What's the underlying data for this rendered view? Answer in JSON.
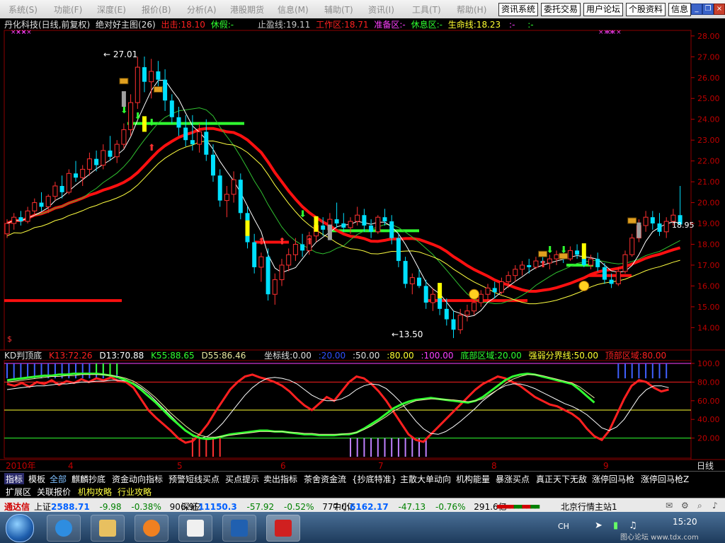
{
  "menubar": {
    "items": [
      "系统(S)",
      "功能(F)",
      "深度(E)",
      "报价(B)",
      "分析(A)",
      "港股期货",
      "信息(M)",
      "辅助(T)",
      "资讯(I)",
      "工具(T)",
      "帮助(H)"
    ],
    "buttons": [
      "资讯系统",
      "委托交易",
      "用户论坛",
      "个股资料",
      "信息"
    ]
  },
  "main_header": {
    "stock": "丹化科技(日线,前复权)",
    "indicator": "绝对好主图(26)",
    "items": [
      {
        "label": "出击:18.10",
        "color": "#ff2020"
      },
      {
        "label": "休假:-",
        "color": "#30ff30"
      },
      {
        "label": "止盈线:19.11",
        "color": "#c8c8c8"
      },
      {
        "label": "工作区:18.71",
        "color": "#ff2020"
      },
      {
        "label": "准备区:-",
        "color": "#ff40ff"
      },
      {
        "label": "休息区:-",
        "color": "#30ff30"
      },
      {
        "label": "生命线:18.23",
        "color": "#ffff30"
      },
      {
        "label": ":-",
        "color": "#ff40ff"
      },
      {
        "label": ":-",
        "color": "#30ff30"
      }
    ]
  },
  "annotations": {
    "high": "27.01",
    "low": "13.50",
    "last": "18.95"
  },
  "sub_header": {
    "items": [
      {
        "label": "KD判顶底",
        "color": "#e0e0e0"
      },
      {
        "label": "K13:72.26",
        "color": "#ff2020"
      },
      {
        "label": "D13:70.88",
        "color": "#ffffff"
      },
      {
        "label": "K55:88.65",
        "color": "#30ff30"
      },
      {
        "label": "D55:86.46",
        "color": "#e8e8a0"
      },
      {
        "label": "坐标线:0.00",
        "color": "#e0e0e0"
      },
      {
        "label": ":20.00",
        "color": "#3050ff"
      },
      {
        "label": ":50.00",
        "color": "#e0e0e0"
      },
      {
        "label": ":80.00",
        "color": "#ffff30"
      },
      {
        "label": ":100.00",
        "color": "#ff40ff"
      },
      {
        "label": "底部区域:20.00",
        "color": "#30ff30"
      },
      {
        "label": "强弱分界线:50.00",
        "color": "#ffff30"
      },
      {
        "label": "顶部区域:80.00",
        "color": "#ff2020"
      }
    ]
  },
  "axis": {
    "price_ticks": [
      "28.00",
      "27.00",
      "26.00",
      "25.00",
      "24.00",
      "23.00",
      "22.00",
      "21.00",
      "20.00",
      "19.00",
      "18.00",
      "17.00",
      "16.00",
      "15.00",
      "14.00"
    ],
    "osc_ticks": [
      "100.0",
      "80.00",
      "60.00",
      "40.00",
      "20.00"
    ],
    "period_label": "日线",
    "date_labels": [
      "2010年",
      "4",
      "5",
      "6",
      "7",
      "8",
      "9"
    ]
  },
  "chart_data": {
    "type": "candlestick",
    "price_range": [
      13.3,
      28.3
    ],
    "candles": [
      [
        18.5,
        19.2,
        18.3,
        19.0
      ],
      [
        19.0,
        19.5,
        18.7,
        19.3
      ],
      [
        19.3,
        19.6,
        18.9,
        19.1
      ],
      [
        19.1,
        19.8,
        19.0,
        19.6
      ],
      [
        19.6,
        20.2,
        19.4,
        20.0
      ],
      [
        20.0,
        20.5,
        19.6,
        19.8
      ],
      [
        19.8,
        20.4,
        19.5,
        20.3
      ],
      [
        20.3,
        21.0,
        20.1,
        20.8
      ],
      [
        20.8,
        21.3,
        20.2,
        20.5
      ],
      [
        20.5,
        21.6,
        20.4,
        21.4
      ],
      [
        21.4,
        22.0,
        21.0,
        21.2
      ],
      [
        21.2,
        21.8,
        20.8,
        21.6
      ],
      [
        21.6,
        22.4,
        21.3,
        22.1
      ],
      [
        22.1,
        22.5,
        21.5,
        21.8
      ],
      [
        21.8,
        22.8,
        21.6,
        22.5
      ],
      [
        22.5,
        23.2,
        22.0,
        22.2
      ],
      [
        22.2,
        23.0,
        21.9,
        22.8
      ],
      [
        22.8,
        23.8,
        22.6,
        23.5
      ],
      [
        23.5,
        25.2,
        23.2,
        24.8
      ],
      [
        24.8,
        27.0,
        24.5,
        26.5
      ],
      [
        26.5,
        27.01,
        25.3,
        25.8
      ],
      [
        25.8,
        26.9,
        25.0,
        26.3
      ],
      [
        26.3,
        26.8,
        25.5,
        25.9
      ],
      [
        25.9,
        26.4,
        24.4,
        24.9
      ],
      [
        24.9,
        25.2,
        23.8,
        24.1
      ],
      [
        24.1,
        24.6,
        23.2,
        23.6
      ],
      [
        23.6,
        24.2,
        22.7,
        23.0
      ],
      [
        23.0,
        24.2,
        22.5,
        22.8
      ],
      [
        22.8,
        23.8,
        22.4,
        23.4
      ],
      [
        23.4,
        24.0,
        22.0,
        22.3
      ],
      [
        22.3,
        22.8,
        21.0,
        21.3
      ],
      [
        21.3,
        21.6,
        19.8,
        20.1
      ],
      [
        20.1,
        20.8,
        19.3,
        20.4
      ],
      [
        20.4,
        21.5,
        20.0,
        21.1
      ],
      [
        21.1,
        21.4,
        19.2,
        19.5
      ],
      [
        19.5,
        19.8,
        17.8,
        18.1
      ],
      [
        18.1,
        18.5,
        16.6,
        16.9
      ],
      [
        16.9,
        17.6,
        16.2,
        17.4
      ],
      [
        17.4,
        17.8,
        15.3,
        15.6
      ],
      [
        15.6,
        16.6,
        15.1,
        16.3
      ],
      [
        16.3,
        17.3,
        16.0,
        17.0
      ],
      [
        17.0,
        17.8,
        16.7,
        17.5
      ],
      [
        17.5,
        18.3,
        17.2,
        18.0
      ],
      [
        18.0,
        18.5,
        17.4,
        17.7
      ],
      [
        17.7,
        18.6,
        17.5,
        18.4
      ],
      [
        18.4,
        19.2,
        18.1,
        18.9
      ],
      [
        18.9,
        19.3,
        18.4,
        18.7
      ],
      [
        18.7,
        19.5,
        18.5,
        19.2
      ],
      [
        19.2,
        20.0,
        18.8,
        19.0
      ],
      [
        19.0,
        19.5,
        18.6,
        18.8
      ],
      [
        18.8,
        19.3,
        18.5,
        19.1
      ],
      [
        19.1,
        19.8,
        18.9,
        19.4
      ],
      [
        19.4,
        19.7,
        18.6,
        18.9
      ],
      [
        18.9,
        19.2,
        18.3,
        18.6
      ],
      [
        18.6,
        19.4,
        18.5,
        19.3
      ],
      [
        19.3,
        19.7,
        18.9,
        19.1
      ],
      [
        19.1,
        19.4,
        18.0,
        18.3
      ],
      [
        18.3,
        18.5,
        16.9,
        17.2
      ],
      [
        17.2,
        17.4,
        15.9,
        16.1
      ],
      [
        16.1,
        16.6,
        15.6,
        16.4
      ],
      [
        16.4,
        16.8,
        15.9,
        16.0
      ],
      [
        16.0,
        16.3,
        14.9,
        15.2
      ],
      [
        15.2,
        15.9,
        14.8,
        15.6
      ],
      [
        15.6,
        15.8,
        14.6,
        14.9
      ],
      [
        14.9,
        15.4,
        14.1,
        14.4
      ],
      [
        14.4,
        14.8,
        13.5,
        13.9
      ],
      [
        13.9,
        14.9,
        13.7,
        14.6
      ],
      [
        14.6,
        15.1,
        14.3,
        14.8
      ],
      [
        14.8,
        15.4,
        14.6,
        15.2
      ],
      [
        15.2,
        15.8,
        15.0,
        15.6
      ],
      [
        15.6,
        16.1,
        15.3,
        15.9
      ],
      [
        15.9,
        16.2,
        15.4,
        15.7
      ],
      [
        15.7,
        16.4,
        15.6,
        16.2
      ],
      [
        16.2,
        16.7,
        15.9,
        16.5
      ],
      [
        16.5,
        17.0,
        16.2,
        16.8
      ],
      [
        16.8,
        17.2,
        16.5,
        17.0
      ],
      [
        17.0,
        17.3,
        16.6,
        16.9
      ],
      [
        16.9,
        17.4,
        16.8,
        17.2
      ],
      [
        17.2,
        17.5,
        16.9,
        17.1
      ],
      [
        17.1,
        17.5,
        16.8,
        17.3
      ],
      [
        17.3,
        17.7,
        17.0,
        17.5
      ],
      [
        17.5,
        17.8,
        17.1,
        17.3
      ],
      [
        17.3,
        17.9,
        17.2,
        17.7
      ],
      [
        17.7,
        18.0,
        17.3,
        17.5
      ],
      [
        17.5,
        17.8,
        16.9,
        17.0
      ],
      [
        17.0,
        17.5,
        16.8,
        17.3
      ],
      [
        17.3,
        17.6,
        16.7,
        16.9
      ],
      [
        16.9,
        17.1,
        16.1,
        16.3
      ],
      [
        16.3,
        16.6,
        15.9,
        16.1
      ],
      [
        16.1,
        16.9,
        16.0,
        16.7
      ],
      [
        16.7,
        17.7,
        16.6,
        17.5
      ],
      [
        17.5,
        18.5,
        17.4,
        18.3
      ],
      [
        18.3,
        19.2,
        18.1,
        18.9
      ],
      [
        18.9,
        19.6,
        18.6,
        19.3
      ],
      [
        19.3,
        19.6,
        18.7,
        19.0
      ],
      [
        19.0,
        19.5,
        18.4,
        18.6
      ],
      [
        18.6,
        19.3,
        18.3,
        19.1
      ],
      [
        19.1,
        19.7,
        18.9,
        19.4
      ],
      [
        19.4,
        20.8,
        19.0,
        18.95
      ]
    ],
    "ma_fast_start": 18.6,
    "ma_slow_start": 17.8,
    "oscillator": {
      "range": [
        0,
        100
      ],
      "levels": [
        20,
        50,
        80,
        100
      ],
      "series": [
        {
          "name": "K13",
          "color": "#ff2020",
          "values": [
            78,
            76,
            79,
            75,
            80,
            78,
            82,
            77,
            81,
            79,
            83,
            80,
            84,
            82,
            85,
            81,
            80,
            74,
            62,
            50,
            42,
            35,
            28,
            20,
            15,
            17,
            25,
            35,
            48,
            60,
            72,
            80,
            86,
            88,
            85,
            83,
            80,
            76,
            70,
            62,
            55,
            50,
            57,
            64,
            60,
            70,
            80,
            86,
            84,
            78,
            70,
            60,
            48,
            36,
            24,
            18,
            16,
            24,
            32,
            40,
            48,
            56,
            64,
            72,
            78,
            82,
            86,
            84,
            80,
            76,
            70,
            64,
            60,
            56,
            54,
            50,
            46,
            40,
            30,
            22,
            18,
            28,
            45,
            62,
            76,
            82,
            80,
            74,
            70,
            72
          ]
        },
        {
          "name": "D13",
          "color": "#ffffff",
          "values": [
            72,
            73,
            74,
            75,
            76,
            76,
            77,
            78,
            78,
            79,
            80,
            80,
            81,
            81,
            82,
            82,
            81,
            79,
            74,
            68,
            60,
            52,
            44,
            36,
            28,
            22,
            20,
            22,
            28,
            36,
            46,
            56,
            66,
            74,
            80,
            84,
            85,
            84,
            82,
            78,
            72,
            66,
            62,
            60,
            60,
            62,
            66,
            72,
            76,
            78,
            77,
            73,
            66,
            58,
            48,
            38,
            30,
            25,
            24,
            27,
            32,
            38,
            45,
            52,
            60,
            66,
            72,
            76,
            78,
            78,
            76,
            73,
            69,
            65,
            61,
            57,
            54,
            50,
            45,
            38,
            31,
            28,
            32,
            40,
            52,
            64,
            72,
            76,
            76,
            74
          ]
        },
        {
          "name": "K55",
          "color": "#30ff30",
          "values": [
            82,
            83,
            84,
            85,
            86,
            87,
            87,
            88,
            88,
            89,
            89,
            89,
            89,
            88,
            87,
            85,
            82,
            78,
            72,
            65,
            58,
            50,
            42,
            35,
            28,
            23,
            20,
            19,
            20,
            22,
            24,
            25,
            26,
            27,
            28,
            28,
            27,
            27,
            26,
            25,
            24,
            24,
            23,
            23,
            23,
            24,
            24,
            26,
            30,
            35,
            40,
            46,
            52,
            56,
            59,
            61,
            62,
            63,
            62,
            61,
            60,
            59,
            58,
            60,
            64,
            70,
            76,
            82,
            86,
            88,
            89,
            88,
            86,
            84,
            82,
            80,
            78,
            72,
            65,
            58
          ]
        },
        {
          "name": "D55",
          "color": "#e8e8a0",
          "values": [
            80,
            81,
            82,
            83,
            84,
            85,
            86,
            86,
            87,
            87,
            88,
            88,
            88,
            88,
            87,
            86,
            84,
            81,
            76,
            70,
            63,
            55,
            47,
            40,
            33,
            27,
            23,
            21,
            21,
            22,
            23,
            24,
            25,
            26,
            27,
            27,
            27,
            27,
            26,
            26,
            25,
            25,
            24,
            24,
            24,
            24,
            25,
            26,
            29,
            33,
            38,
            43,
            49,
            53,
            57,
            60,
            61,
            62,
            62,
            61,
            61,
            60,
            59,
            60,
            62,
            67,
            72,
            78,
            83,
            86,
            88,
            88,
            87,
            85,
            83,
            81,
            79,
            75,
            69,
            63
          ]
        }
      ]
    }
  },
  "tabs_row1": [
    "指标",
    "模板",
    "全部",
    "麒麟抄底",
    "资金动向指标",
    "预警短线买点",
    "买点提示",
    "卖出指标",
    "茶舍资金流",
    "{抄底特准}",
    "主散大单动向",
    "机构能量",
    "暴涨买点",
    "真正天下无敌",
    "涨停回马枪",
    "涨停回马枪Z"
  ],
  "tabs_row2": [
    "扩展区",
    "关联报价",
    "机构攻略",
    "行业攻略"
  ],
  "statusbar": {
    "logo": "通达信",
    "sh": {
      "name": "上证",
      "value": "2588.71",
      "chg": "-9.98",
      "pct": "-0.38%",
      "amt": "906.9亿"
    },
    "sz": {
      "name": "深证",
      "value": "11150.3",
      "chg": "-57.92",
      "pct": "-0.52%",
      "amt": "777.0亿"
    },
    "zx": {
      "name": "中小",
      "value": "6162.17",
      "chg": "-47.13",
      "pct": "-0.76%",
      "amt": "291.6亿"
    },
    "server": "北京行情主站1"
  },
  "taskbar": {
    "time": "15:20",
    "lang": "CH",
    "watermark": "图心论坛 www.tdx.com"
  },
  "colors": {
    "up": "#ff3030",
    "down": "#00e0ff",
    "ma_fast": "#ffffff",
    "ma_slow": "#ffff40",
    "lifeline": "#ff1010",
    "grid": "#8b0000"
  }
}
